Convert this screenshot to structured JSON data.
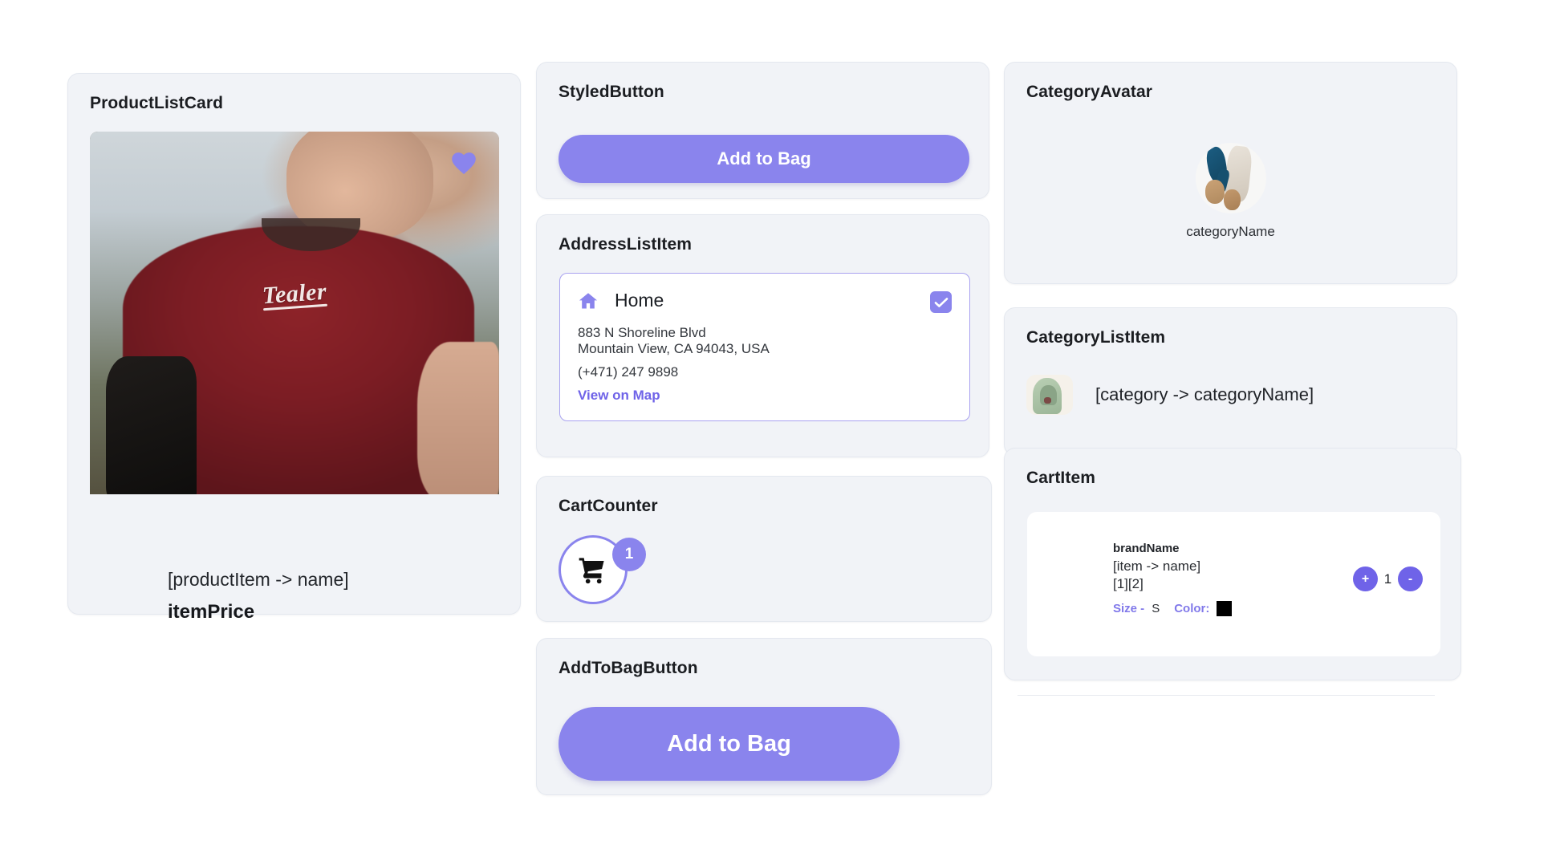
{
  "theme": {
    "accent": "#8a84ed",
    "accent_strong": "#6f63e8",
    "panel_bg": "#f1f3f7",
    "page_bg": "#ffffff",
    "text": "#1b1d21",
    "swatch_black": "#000000"
  },
  "product_list_card": {
    "title": "ProductListCard",
    "favorite_icon": "heart-icon",
    "photo_brand_text": "Tealer",
    "name": "[productItem -> name]",
    "price": "itemPrice"
  },
  "styled_button": {
    "title": "StyledButton",
    "button_label": "Add to Bag"
  },
  "address_list_item": {
    "title": "AddressListItem",
    "home_icon": "home-icon",
    "label": "Home",
    "selected": true,
    "check_icon": "check-icon",
    "street": "883 N Shoreline Blvd",
    "city_region": "Mountain View, CA 94043, USA",
    "phone": "(+471) 247 9898",
    "map_link": "View on Map"
  },
  "cart_counter": {
    "title": "CartCounter",
    "cart_icon": "shopping-cart-icon",
    "badge_count": "1"
  },
  "add_to_bag_button": {
    "title": "AddToBagButton",
    "button_label": "Add to Bag"
  },
  "category_avatar": {
    "title": "CategoryAvatar",
    "avatar_icon": "category-avatar-image",
    "name": "categoryName"
  },
  "category_list_item": {
    "title": "CategoryListItem",
    "thumb_icon": "category-thumbnail-image",
    "label": "[category -> categoryName]"
  },
  "cart_item": {
    "title": "CartItem",
    "brand_name": "brandName",
    "item_name": "[item -> name]",
    "item_code": "[1][2]",
    "size_label": "Size -",
    "size_value": "S",
    "color_label": "Color:",
    "color_value": "#000000",
    "increment_label": "+",
    "decrement_label": "-",
    "quantity": "1"
  }
}
